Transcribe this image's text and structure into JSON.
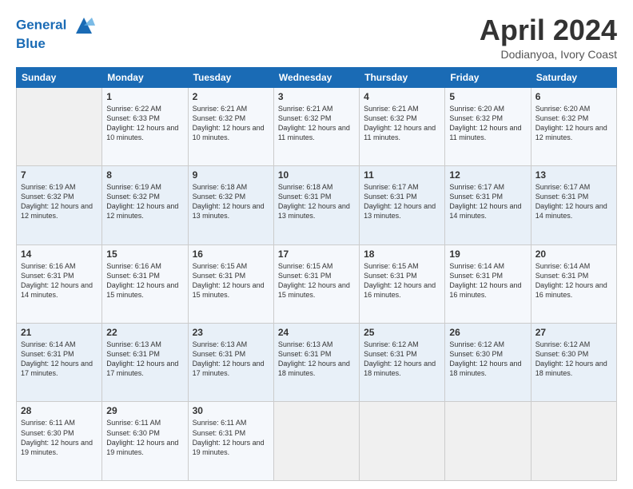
{
  "logo": {
    "line1": "General",
    "line2": "Blue"
  },
  "title": "April 2024",
  "subtitle": "Dodianyoa, Ivory Coast",
  "weekdays": [
    "Sunday",
    "Monday",
    "Tuesday",
    "Wednesday",
    "Thursday",
    "Friday",
    "Saturday"
  ],
  "weeks": [
    [
      {
        "day": "",
        "sunrise": "",
        "sunset": "",
        "daylight": ""
      },
      {
        "day": "1",
        "sunrise": "Sunrise: 6:22 AM",
        "sunset": "Sunset: 6:33 PM",
        "daylight": "Daylight: 12 hours and 10 minutes."
      },
      {
        "day": "2",
        "sunrise": "Sunrise: 6:21 AM",
        "sunset": "Sunset: 6:32 PM",
        "daylight": "Daylight: 12 hours and 10 minutes."
      },
      {
        "day": "3",
        "sunrise": "Sunrise: 6:21 AM",
        "sunset": "Sunset: 6:32 PM",
        "daylight": "Daylight: 12 hours and 11 minutes."
      },
      {
        "day": "4",
        "sunrise": "Sunrise: 6:21 AM",
        "sunset": "Sunset: 6:32 PM",
        "daylight": "Daylight: 12 hours and 11 minutes."
      },
      {
        "day": "5",
        "sunrise": "Sunrise: 6:20 AM",
        "sunset": "Sunset: 6:32 PM",
        "daylight": "Daylight: 12 hours and 11 minutes."
      },
      {
        "day": "6",
        "sunrise": "Sunrise: 6:20 AM",
        "sunset": "Sunset: 6:32 PM",
        "daylight": "Daylight: 12 hours and 12 minutes."
      }
    ],
    [
      {
        "day": "7",
        "sunrise": "Sunrise: 6:19 AM",
        "sunset": "Sunset: 6:32 PM",
        "daylight": "Daylight: 12 hours and 12 minutes."
      },
      {
        "day": "8",
        "sunrise": "Sunrise: 6:19 AM",
        "sunset": "Sunset: 6:32 PM",
        "daylight": "Daylight: 12 hours and 12 minutes."
      },
      {
        "day": "9",
        "sunrise": "Sunrise: 6:18 AM",
        "sunset": "Sunset: 6:32 PM",
        "daylight": "Daylight: 12 hours and 13 minutes."
      },
      {
        "day": "10",
        "sunrise": "Sunrise: 6:18 AM",
        "sunset": "Sunset: 6:31 PM",
        "daylight": "Daylight: 12 hours and 13 minutes."
      },
      {
        "day": "11",
        "sunrise": "Sunrise: 6:17 AM",
        "sunset": "Sunset: 6:31 PM",
        "daylight": "Daylight: 12 hours and 13 minutes."
      },
      {
        "day": "12",
        "sunrise": "Sunrise: 6:17 AM",
        "sunset": "Sunset: 6:31 PM",
        "daylight": "Daylight: 12 hours and 14 minutes."
      },
      {
        "day": "13",
        "sunrise": "Sunrise: 6:17 AM",
        "sunset": "Sunset: 6:31 PM",
        "daylight": "Daylight: 12 hours and 14 minutes."
      }
    ],
    [
      {
        "day": "14",
        "sunrise": "Sunrise: 6:16 AM",
        "sunset": "Sunset: 6:31 PM",
        "daylight": "Daylight: 12 hours and 14 minutes."
      },
      {
        "day": "15",
        "sunrise": "Sunrise: 6:16 AM",
        "sunset": "Sunset: 6:31 PM",
        "daylight": "Daylight: 12 hours and 15 minutes."
      },
      {
        "day": "16",
        "sunrise": "Sunrise: 6:15 AM",
        "sunset": "Sunset: 6:31 PM",
        "daylight": "Daylight: 12 hours and 15 minutes."
      },
      {
        "day": "17",
        "sunrise": "Sunrise: 6:15 AM",
        "sunset": "Sunset: 6:31 PM",
        "daylight": "Daylight: 12 hours and 15 minutes."
      },
      {
        "day": "18",
        "sunrise": "Sunrise: 6:15 AM",
        "sunset": "Sunset: 6:31 PM",
        "daylight": "Daylight: 12 hours and 16 minutes."
      },
      {
        "day": "19",
        "sunrise": "Sunrise: 6:14 AM",
        "sunset": "Sunset: 6:31 PM",
        "daylight": "Daylight: 12 hours and 16 minutes."
      },
      {
        "day": "20",
        "sunrise": "Sunrise: 6:14 AM",
        "sunset": "Sunset: 6:31 PM",
        "daylight": "Daylight: 12 hours and 16 minutes."
      }
    ],
    [
      {
        "day": "21",
        "sunrise": "Sunrise: 6:14 AM",
        "sunset": "Sunset: 6:31 PM",
        "daylight": "Daylight: 12 hours and 17 minutes."
      },
      {
        "day": "22",
        "sunrise": "Sunrise: 6:13 AM",
        "sunset": "Sunset: 6:31 PM",
        "daylight": "Daylight: 12 hours and 17 minutes."
      },
      {
        "day": "23",
        "sunrise": "Sunrise: 6:13 AM",
        "sunset": "Sunset: 6:31 PM",
        "daylight": "Daylight: 12 hours and 17 minutes."
      },
      {
        "day": "24",
        "sunrise": "Sunrise: 6:13 AM",
        "sunset": "Sunset: 6:31 PM",
        "daylight": "Daylight: 12 hours and 18 minutes."
      },
      {
        "day": "25",
        "sunrise": "Sunrise: 6:12 AM",
        "sunset": "Sunset: 6:31 PM",
        "daylight": "Daylight: 12 hours and 18 minutes."
      },
      {
        "day": "26",
        "sunrise": "Sunrise: 6:12 AM",
        "sunset": "Sunset: 6:30 PM",
        "daylight": "Daylight: 12 hours and 18 minutes."
      },
      {
        "day": "27",
        "sunrise": "Sunrise: 6:12 AM",
        "sunset": "Sunset: 6:30 PM",
        "daylight": "Daylight: 12 hours and 18 minutes."
      }
    ],
    [
      {
        "day": "28",
        "sunrise": "Sunrise: 6:11 AM",
        "sunset": "Sunset: 6:30 PM",
        "daylight": "Daylight: 12 hours and 19 minutes."
      },
      {
        "day": "29",
        "sunrise": "Sunrise: 6:11 AM",
        "sunset": "Sunset: 6:30 PM",
        "daylight": "Daylight: 12 hours and 19 minutes."
      },
      {
        "day": "30",
        "sunrise": "Sunrise: 6:11 AM",
        "sunset": "Sunset: 6:31 PM",
        "daylight": "Daylight: 12 hours and 19 minutes."
      },
      {
        "day": "",
        "sunrise": "",
        "sunset": "",
        "daylight": ""
      },
      {
        "day": "",
        "sunrise": "",
        "sunset": "",
        "daylight": ""
      },
      {
        "day": "",
        "sunrise": "",
        "sunset": "",
        "daylight": ""
      },
      {
        "day": "",
        "sunrise": "",
        "sunset": "",
        "daylight": ""
      }
    ]
  ]
}
